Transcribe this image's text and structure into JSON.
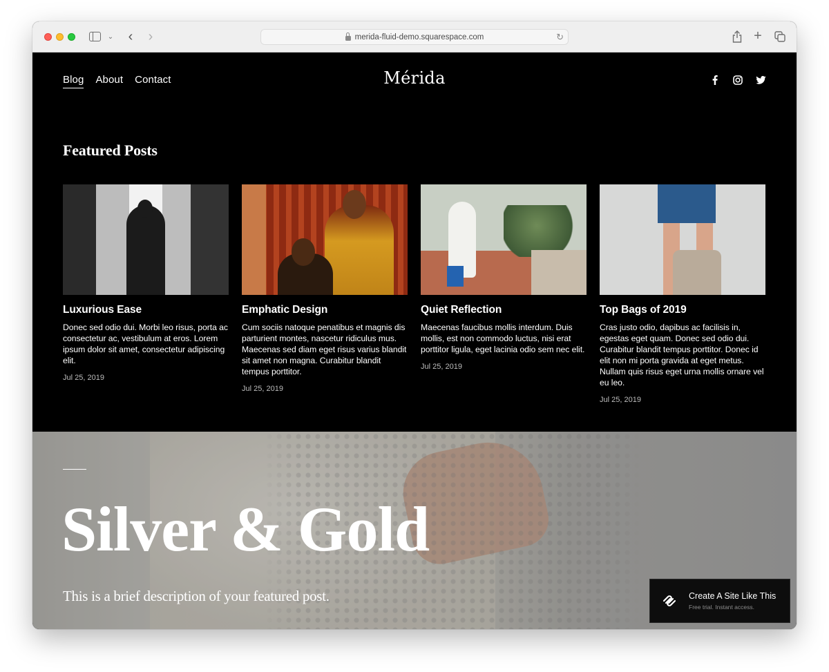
{
  "browser": {
    "url": "merida-fluid-demo.squarespace.com",
    "icons": [
      "sidebar-icon",
      "chevron-down-icon",
      "back-icon",
      "forward-icon",
      "lock-icon",
      "reload-icon",
      "share-icon",
      "plus-icon",
      "tabs-icon"
    ]
  },
  "header": {
    "nav": [
      {
        "label": "Blog",
        "active": true
      },
      {
        "label": "About",
        "active": false
      },
      {
        "label": "Contact",
        "active": false
      }
    ],
    "logo": "Mérida",
    "social": [
      "facebook-icon",
      "instagram-icon",
      "twitter-icon"
    ]
  },
  "featured": {
    "title": "Featured Posts",
    "posts": [
      {
        "title": "Luxurious Ease",
        "excerpt": "Donec sed odio dui. Morbi leo risus, porta ac consectetur ac, vestibulum at eros. Lorem ipsum dolor sit amet, consectetur adipiscing elit.",
        "date": "Jul 25, 2019"
      },
      {
        "title": "Emphatic Design",
        "excerpt": "Cum sociis natoque penatibus et magnis dis parturient montes, nascetur ridiculus mus. Maecenas sed diam eget risus varius blandit sit amet non magna. Curabitur blandit tempus porttitor.",
        "date": "Jul 25, 2019"
      },
      {
        "title": "Quiet Reflection",
        "excerpt": "Maecenas faucibus mollis interdum. Duis mollis, est non commodo luctus, nisi erat porttitor ligula, eget lacinia odio sem nec elit.",
        "date": "Jul 25, 2019"
      },
      {
        "title": "Top Bags of 2019",
        "excerpt": "Cras justo odio, dapibus ac facilisis in, egestas eget quam. Donec sed odio dui. Curabitur blandit tempus porttitor. Donec id elit non mi porta gravida at eget metus. Nullam quis risus eget urna mollis ornare vel eu leo.",
        "date": "Jul 25, 2019"
      }
    ]
  },
  "hero": {
    "title": "Silver & Gold",
    "description": "This is a brief description of your featured post."
  },
  "cta": {
    "title": "Create A Site Like This",
    "subtitle": "Free trial. Instant access."
  },
  "colors": {
    "page_bg": "#000000",
    "text": "#ffffff",
    "date_text": "#bdbdbd",
    "chrome_bg": "#efefef"
  }
}
